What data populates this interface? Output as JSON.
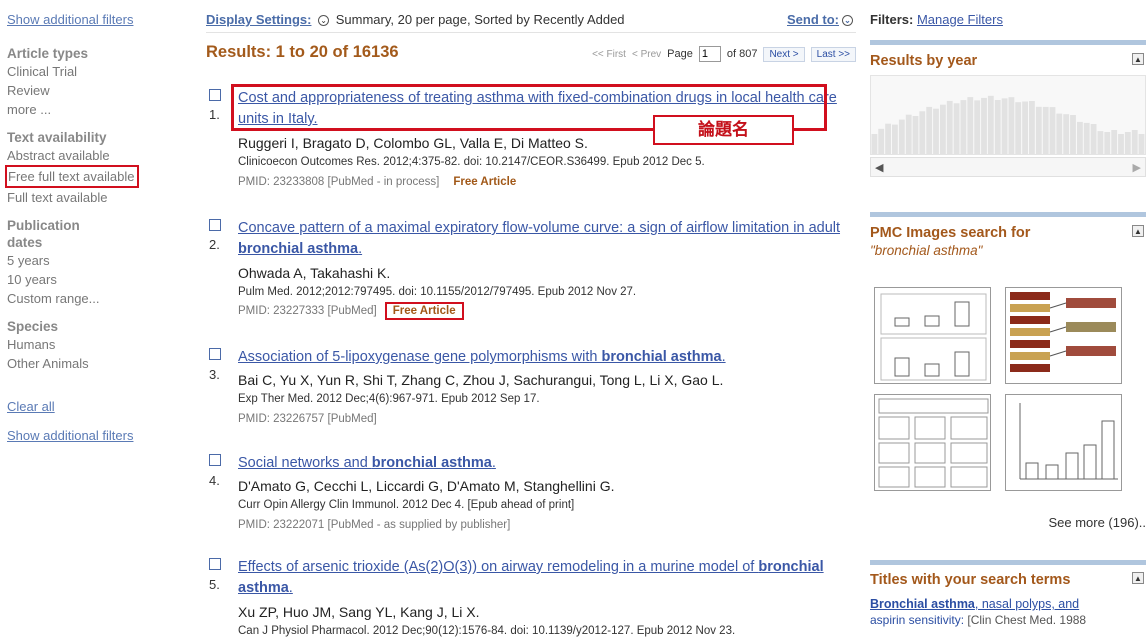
{
  "left": {
    "show_filters_top": "Show additional filters",
    "article_types_heading": "Article types",
    "article_types": [
      "Clinical Trial",
      "Review",
      "more ..."
    ],
    "text_availability_heading": "Text availability",
    "text_availability": [
      "Abstract available",
      "Free full text available",
      "Full text available"
    ],
    "publication_dates_heading": "Publication dates",
    "publication_dates": [
      "5 years",
      "10 years",
      "Custom range..."
    ],
    "species_heading": "Species",
    "species": [
      "Humans",
      "Other Animals"
    ],
    "clear_all": "Clear all",
    "show_filters_bottom": "Show additional filters"
  },
  "display": {
    "label": "Display Settings:",
    "value": "Summary, 20 per page, Sorted by Recently Added",
    "send_to": "Send to:"
  },
  "results": {
    "title": "Results: 1 to 20 of 16136",
    "first": "<< First",
    "prev": "< Prev",
    "page_label": "Page",
    "page_value": "1",
    "of_pages": "of 807",
    "next": "Next >",
    "last": "Last >>"
  },
  "items": [
    {
      "num": "1.",
      "title_plain": "Cost and appropriateness of treating asthma with fixed-combination drugs in local health care units in Italy.",
      "authors": "Ruggeri I, Bragato D, Colombo GL, Valla E, Di Matteo S.",
      "citation": "Clinicoecon Outcomes Res. 2012;4:375-82. doi: 10.2147/CEOR.S36499. Epub 2012 Dec 5.",
      "pmid": "PMID: 23233808 [PubMed - in process]",
      "free": "Free Article"
    },
    {
      "num": "2.",
      "title_plain": "Concave pattern of a maximal expiratory flow-volume curve: a sign of airflow limitation in adult ",
      "title_bold": "bronchial asthma",
      "title_end": ".",
      "authors": "Ohwada A, Takahashi K.",
      "citation": "Pulm Med. 2012;2012:797495. doi: 10.1155/2012/797495. Epub 2012 Nov 27.",
      "pmid": "PMID: 23227333 [PubMed]",
      "free": "Free Article"
    },
    {
      "num": "3.",
      "title_plain": "Association of 5-lipoxygenase gene polymorphisms with ",
      "title_bold": "bronchial asthma",
      "title_end": ".",
      "authors": "Bai C, Yu X, Yun R, Shi T, Zhang C, Zhou J, Sachurangui, Tong L, Li X, Gao L.",
      "citation": "Exp Ther Med. 2012 Dec;4(6):967-971. Epub 2012 Sep 17.",
      "pmid": "PMID: 23226757 [PubMed]"
    },
    {
      "num": "4.",
      "title_plain": "Social networks and ",
      "title_bold": "bronchial asthma",
      "title_end": ".",
      "authors": "D'Amato G, Cecchi L, Liccardi G, D'Amato M, Stanghellini G.",
      "citation": "Curr Opin Allergy Clin Immunol. 2012 Dec 4. [Epub ahead of print]",
      "pmid": "PMID: 23222071 [PubMed - as supplied by publisher]"
    },
    {
      "num": "5.",
      "title_plain": "Effects of arsenic trioxide (As(2)O(3)) on airway remodeling in a murine model of ",
      "title_bold": "bronchial asthma",
      "title_end": ".",
      "authors": "Xu ZP, Huo JM, Sang YL, Kang J, Li X.",
      "citation": "Can J Physiol Pharmacol. 2012 Dec;90(12):1576-84. doi: 10.1139/y2012-127. Epub 2012 Nov 23."
    }
  ],
  "annotation": {
    "label": "論題名"
  },
  "right": {
    "filters_label": "Filters:",
    "manage_filters": "Manage Filters",
    "results_by_year": "Results by year",
    "pmc_title": "PMC Images search for",
    "pmc_query": "\"bronchial asthma\"",
    "see_more": "See more (196)..",
    "titles_heading": "Titles with your search terms",
    "t1_bold": "Bronchial asthma",
    "t1_rest": ", nasal polyps, and",
    "t1_line2": "aspirin sensitivity: ",
    "t1_journal": "[Clin Chest Med. 1988"
  },
  "colors": {
    "link": "#3a57a6",
    "results_title": "#a35a1b",
    "highlight_box": "#d10f1e",
    "free_article": "#a15818"
  }
}
